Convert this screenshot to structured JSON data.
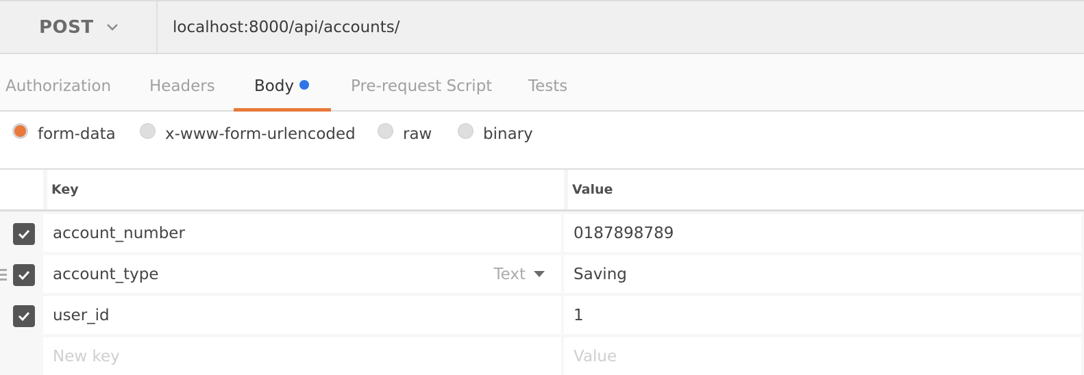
{
  "request": {
    "method": "POST",
    "url": "localhost:8000/api/accounts/"
  },
  "tabs": [
    {
      "label": "Authorization",
      "active": false
    },
    {
      "label": "Headers",
      "active": false
    },
    {
      "label": "Body",
      "active": true,
      "indicator": "blue-dot"
    },
    {
      "label": "Pre-request Script",
      "active": false
    },
    {
      "label": "Tests",
      "active": false
    }
  ],
  "body_types": [
    {
      "label": "form-data",
      "checked": true
    },
    {
      "label": "x-www-form-urlencoded",
      "checked": false
    },
    {
      "label": "raw",
      "checked": false
    },
    {
      "label": "binary",
      "checked": false
    }
  ],
  "table": {
    "headers": {
      "key": "Key",
      "value": "Value"
    },
    "rows": [
      {
        "key": "account_number",
        "value": "0187898789",
        "enabled": true
      },
      {
        "key": "account_type",
        "value": "Saving",
        "enabled": true,
        "type": "Text"
      },
      {
        "key": "user_id",
        "value": "1",
        "enabled": true
      }
    ],
    "new_row": {
      "key_placeholder": "New key",
      "value_placeholder": "Value"
    }
  },
  "colors": {
    "accent": "#e8793b",
    "indicator": "#2f74e8"
  }
}
